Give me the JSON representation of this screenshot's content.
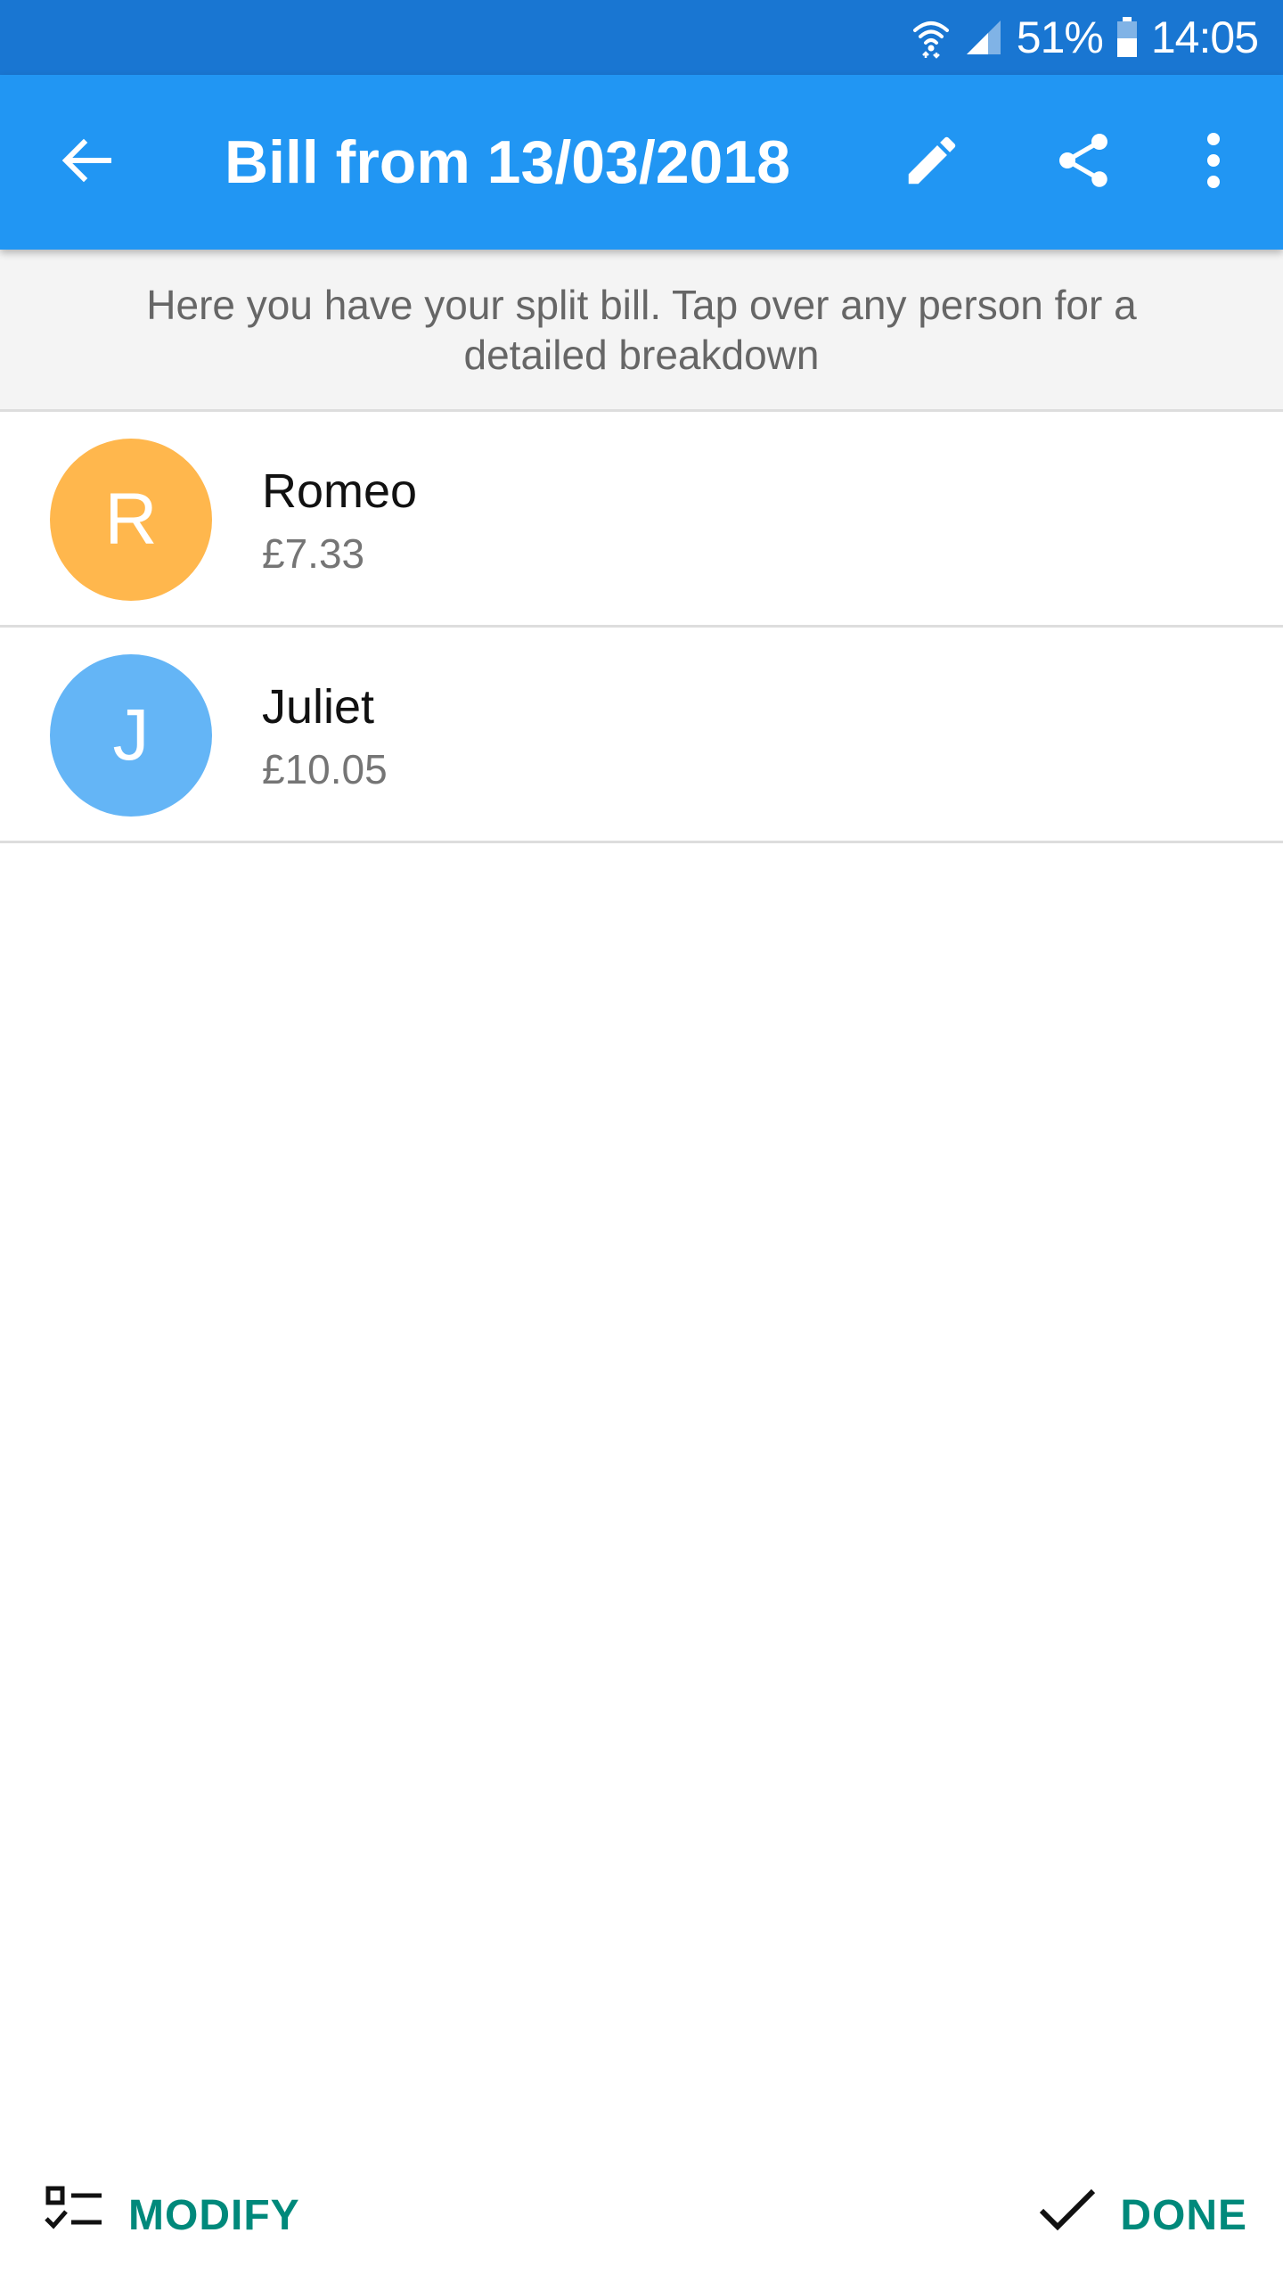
{
  "status_bar": {
    "battery": "51%",
    "time": "14:05",
    "icons": [
      "wifi-icon",
      "signal-icon",
      "battery-icon"
    ],
    "background": "#1976D2"
  },
  "app_bar": {
    "title": "Bill from 13/03/2018",
    "background": "#2196F3",
    "icons": [
      "arrow-back-icon",
      "pencil-icon",
      "share-icon",
      "more-vert-icon"
    ]
  },
  "banner": {
    "text": "Here you have your split bill. Tap over any person for a detailed breakdown"
  },
  "people": [
    {
      "initial": "R",
      "name": "Romeo",
      "amount": "£7.33",
      "color": "#FFB74D"
    },
    {
      "initial": "J",
      "name": "Juliet",
      "amount": "£10.05",
      "color": "#64B5F6"
    }
  ],
  "bottom_bar": {
    "modify_label": "MODIFY",
    "done_label": "DONE",
    "accent": "#00897B",
    "icons": [
      "checklist-icon",
      "check-icon"
    ]
  }
}
